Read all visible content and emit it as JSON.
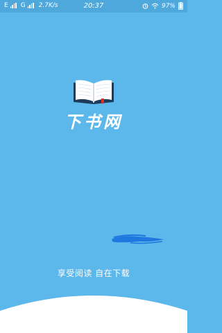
{
  "status_bar": {
    "sim1": "E",
    "sim2": "G",
    "speed": "2.7K/s",
    "time": "20:37",
    "battery": "97%",
    "icons": [
      "signal-icon",
      "alarm-icon",
      "wifi-icon",
      "battery-icon"
    ]
  },
  "splash": {
    "brand": "下书网",
    "tagline": "享受阅读 自在下载",
    "logo_icon": "open-book-icon"
  },
  "colors": {
    "background": "#5cb7ea",
    "status_bar": "#4ea8dc",
    "book_cover": "#1e3b5c",
    "bookmark": "#d9302a",
    "bottom_panel": "#ffffff"
  }
}
